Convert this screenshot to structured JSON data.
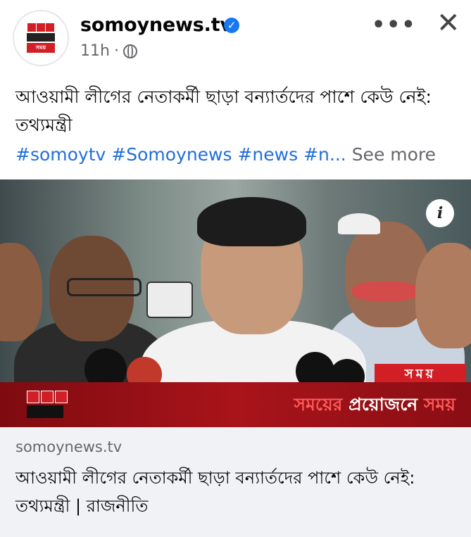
{
  "header": {
    "page_name": "somoynews.tv",
    "time": "11h",
    "separator": "·",
    "more_icon": "•••",
    "close_icon": "✕",
    "verified_icon": "✓",
    "avatar_logo_text": "সময়"
  },
  "post": {
    "caption": "আওয়ামী লীগের নেতাকর্মী ছাড়া বন্যার্তদের পাশে কেউ নেই: তথ্যমন্ত্রী",
    "hashtags": [
      "#somoytv",
      "#Somoynews",
      "#news",
      "#n..."
    ],
    "see_more": "See more"
  },
  "image": {
    "info_icon": "i",
    "corner_tag": "সময়",
    "ticker_logo": "সময়",
    "ticker_text_a": "সময়ের ",
    "ticker_text_b": "প্রয়োজনে ",
    "ticker_text_c": "সময়"
  },
  "link_preview": {
    "domain": "somoynews.tv",
    "title": "আওয়ামী লীগের নেতাকর্মী ছাড়া বন্যার্তদের পাশে কেউ নেই: তথ্যমন্ত্রী | রাজনীতি"
  },
  "colors": {
    "accent": "#1877f2",
    "hashtag": "#216fdb",
    "brand_red": "#d21f26"
  }
}
